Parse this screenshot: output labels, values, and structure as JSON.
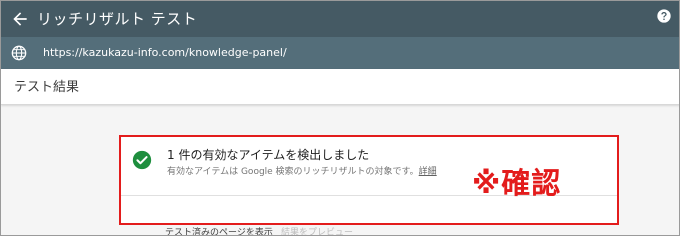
{
  "header": {
    "title": "リッチリザルト テスト",
    "back_icon": "arrow-back-icon",
    "help_icon": "help-icon"
  },
  "url_bar": {
    "icon": "globe-icon",
    "url": "https://kazukazu-info.com/knowledge-panel/"
  },
  "results": {
    "title": "テスト結果"
  },
  "card": {
    "status_icon": "check-circle-icon",
    "heading": "1 件の有効なアイテムを検出しました",
    "subtext": "有効なアイテムは Google 検索のリッチリザルトの対象です。",
    "detail_link": "詳細",
    "view_tested_page": "テスト済みのページを表示",
    "preview_results": "結果をプレビュー"
  },
  "annotation": {
    "text": "※確認"
  },
  "colors": {
    "header_bg": "#455a64",
    "url_bar_bg": "#546e7a",
    "check_green": "#1e8e3e",
    "highlight_red": "#e31c1c"
  }
}
